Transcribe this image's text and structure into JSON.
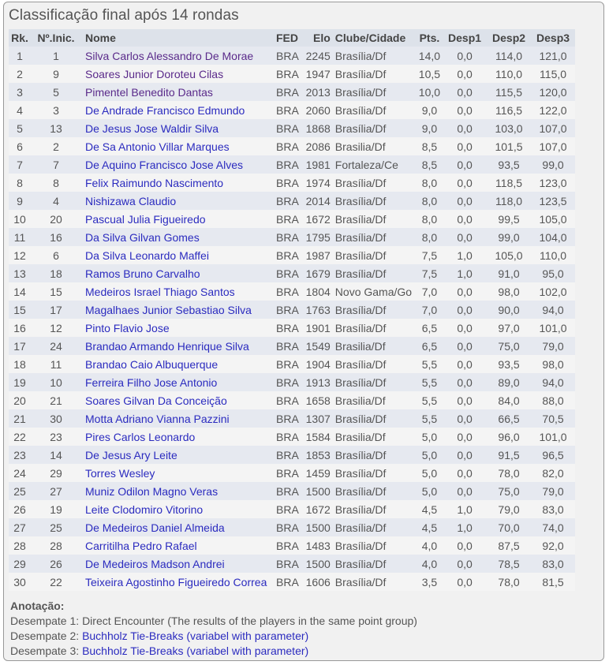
{
  "title": "Classificação final após 14 rondas",
  "columns": [
    "Rk.",
    "Nº.Inic.",
    "Nome",
    "FED",
    "Elo",
    "Clube/Cidade",
    "Pts.",
    "Desp1",
    "Desp2",
    "Desp3"
  ],
  "link_color": "#2b2bbf",
  "visited_link_color": "#5a2a8a",
  "rows": [
    {
      "rk": "1",
      "start": "1",
      "name": "Silva Carlos Alessandro De Morae",
      "fed": "BRA",
      "elo": "2245",
      "club": "Brasília/Df",
      "pts": "14,0",
      "d1": "0,0",
      "d2": "114,0",
      "d3": "121,0",
      "visited": true
    },
    {
      "rk": "2",
      "start": "9",
      "name": "Soares Junior Doroteu Cilas",
      "fed": "BRA",
      "elo": "1947",
      "club": "Brasília/Df",
      "pts": "10,5",
      "d1": "0,0",
      "d2": "110,0",
      "d3": "115,0",
      "visited": true
    },
    {
      "rk": "3",
      "start": "5",
      "name": "Pimentel Benedito Dantas",
      "fed": "BRA",
      "elo": "2013",
      "club": "Brasília/Df",
      "pts": "10,0",
      "d1": "0,0",
      "d2": "115,5",
      "d3": "120,0",
      "visited": true
    },
    {
      "rk": "4",
      "start": "3",
      "name": "De Andrade Francisco Edmundo",
      "fed": "BRA",
      "elo": "2060",
      "club": "Brasília/Df",
      "pts": "9,0",
      "d1": "0,0",
      "d2": "116,5",
      "d3": "122,0"
    },
    {
      "rk": "5",
      "start": "13",
      "name": "De Jesus Jose Waldir Silva",
      "fed": "BRA",
      "elo": "1868",
      "club": "Brasília/Df",
      "pts": "9,0",
      "d1": "0,0",
      "d2": "103,0",
      "d3": "107,0"
    },
    {
      "rk": "6",
      "start": "2",
      "name": "De Sa Antonio Villar Marques",
      "fed": "BRA",
      "elo": "2086",
      "club": "Brasilia/Df",
      "pts": "8,5",
      "d1": "0,0",
      "d2": "101,5",
      "d3": "107,0"
    },
    {
      "rk": "7",
      "start": "7",
      "name": "De Aquino Francisco Jose Alves",
      "fed": "BRA",
      "elo": "1981",
      "club": "Fortaleza/Ce",
      "pts": "8,5",
      "d1": "0,0",
      "d2": "93,5",
      "d3": "99,0"
    },
    {
      "rk": "8",
      "start": "8",
      "name": "Felix Raimundo Nascimento",
      "fed": "BRA",
      "elo": "1974",
      "club": "Brasília/Df",
      "pts": "8,0",
      "d1": "0,0",
      "d2": "118,5",
      "d3": "123,0"
    },
    {
      "rk": "9",
      "start": "4",
      "name": "Nishizawa Claudio",
      "fed": "BRA",
      "elo": "2014",
      "club": "Brasília/Df",
      "pts": "8,0",
      "d1": "0,0",
      "d2": "118,0",
      "d3": "123,5"
    },
    {
      "rk": "10",
      "start": "20",
      "name": "Pascual Julia Figueiredo",
      "fed": "BRA",
      "elo": "1672",
      "club": "Brasília/Df",
      "pts": "8,0",
      "d1": "0,0",
      "d2": "99,5",
      "d3": "105,0"
    },
    {
      "rk": "11",
      "start": "16",
      "name": "Da Silva Gilvan Gomes",
      "fed": "BRA",
      "elo": "1795",
      "club": "Brasília/Df",
      "pts": "8,0",
      "d1": "0,0",
      "d2": "99,0",
      "d3": "104,0"
    },
    {
      "rk": "12",
      "start": "6",
      "name": "Da Silva Leonardo Maffei",
      "fed": "BRA",
      "elo": "1987",
      "club": "Brasília/Df",
      "pts": "7,5",
      "d1": "1,0",
      "d2": "105,0",
      "d3": "110,0"
    },
    {
      "rk": "13",
      "start": "18",
      "name": "Ramos Bruno Carvalho",
      "fed": "BRA",
      "elo": "1679",
      "club": "Brasília/Df",
      "pts": "7,5",
      "d1": "1,0",
      "d2": "91,0",
      "d3": "95,0"
    },
    {
      "rk": "14",
      "start": "15",
      "name": "Medeiros Israel Thiago Santos",
      "fed": "BRA",
      "elo": "1804",
      "club": "Novo Gama/Go",
      "pts": "7,0",
      "d1": "0,0",
      "d2": "98,0",
      "d3": "102,0"
    },
    {
      "rk": "15",
      "start": "17",
      "name": "Magalhaes Junior Sebastiao Silva",
      "fed": "BRA",
      "elo": "1763",
      "club": "Brasília/Df",
      "pts": "7,0",
      "d1": "0,0",
      "d2": "90,0",
      "d3": "94,0"
    },
    {
      "rk": "16",
      "start": "12",
      "name": "Pinto Flavio Jose",
      "fed": "BRA",
      "elo": "1901",
      "club": "Brasília/Df",
      "pts": "6,5",
      "d1": "0,0",
      "d2": "97,0",
      "d3": "101,0"
    },
    {
      "rk": "17",
      "start": "24",
      "name": "Brandao Armando Henrique Silva",
      "fed": "BRA",
      "elo": "1549",
      "club": "Brasilia/Df",
      "pts": "6,5",
      "d1": "0,0",
      "d2": "75,0",
      "d3": "79,0"
    },
    {
      "rk": "18",
      "start": "11",
      "name": "Brandao Caio Albuquerque",
      "fed": "BRA",
      "elo": "1904",
      "club": "Brasília/Df",
      "pts": "5,5",
      "d1": "0,0",
      "d2": "93,5",
      "d3": "98,0"
    },
    {
      "rk": "19",
      "start": "10",
      "name": "Ferreira Filho Jose Antonio",
      "fed": "BRA",
      "elo": "1913",
      "club": "Brasília/Df",
      "pts": "5,5",
      "d1": "0,0",
      "d2": "89,0",
      "d3": "94,0"
    },
    {
      "rk": "20",
      "start": "21",
      "name": "Soares Gilvan Da Conceição",
      "fed": "BRA",
      "elo": "1658",
      "club": "Brasilia/Df",
      "pts": "5,5",
      "d1": "0,0",
      "d2": "84,0",
      "d3": "88,0"
    },
    {
      "rk": "21",
      "start": "30",
      "name": "Motta Adriano Vianna Pazzini",
      "fed": "BRA",
      "elo": "1307",
      "club": "Brasília/Df",
      "pts": "5,5",
      "d1": "0,0",
      "d2": "66,5",
      "d3": "70,5"
    },
    {
      "rk": "22",
      "start": "23",
      "name": "Pires Carlos Leonardo",
      "fed": "BRA",
      "elo": "1584",
      "club": "Brasilia/Df",
      "pts": "5,0",
      "d1": "0,0",
      "d2": "96,0",
      "d3": "101,0"
    },
    {
      "rk": "23",
      "start": "14",
      "name": "De Jesus Ary Leite",
      "fed": "BRA",
      "elo": "1853",
      "club": "Brasília/Df",
      "pts": "5,0",
      "d1": "0,0",
      "d2": "91,5",
      "d3": "96,5"
    },
    {
      "rk": "24",
      "start": "29",
      "name": "Torres Wesley",
      "fed": "BRA",
      "elo": "1459",
      "club": "Brasília/Df",
      "pts": "5,0",
      "d1": "0,0",
      "d2": "78,0",
      "d3": "82,0"
    },
    {
      "rk": "25",
      "start": "27",
      "name": "Muniz Odilon Magno Veras",
      "fed": "BRA",
      "elo": "1500",
      "club": "Brasília/Df",
      "pts": "5,0",
      "d1": "0,0",
      "d2": "75,0",
      "d3": "79,0"
    },
    {
      "rk": "26",
      "start": "19",
      "name": "Leite Clodomiro Vitorino",
      "fed": "BRA",
      "elo": "1672",
      "club": "Brasília/Df",
      "pts": "4,5",
      "d1": "1,0",
      "d2": "79,0",
      "d3": "83,0"
    },
    {
      "rk": "27",
      "start": "25",
      "name": "De Medeiros Daniel Almeida",
      "fed": "BRA",
      "elo": "1500",
      "club": "Brasília/Df",
      "pts": "4,5",
      "d1": "1,0",
      "d2": "70,0",
      "d3": "74,0"
    },
    {
      "rk": "28",
      "start": "28",
      "name": "Carritilha Pedro Rafael",
      "fed": "BRA",
      "elo": "1483",
      "club": "Brasília/Df",
      "pts": "4,0",
      "d1": "0,0",
      "d2": "87,5",
      "d3": "92,0"
    },
    {
      "rk": "29",
      "start": "26",
      "name": "De Medeiros Madson Andrei",
      "fed": "BRA",
      "elo": "1500",
      "club": "Brasília/Df",
      "pts": "4,0",
      "d1": "0,0",
      "d2": "78,5",
      "d3": "83,0"
    },
    {
      "rk": "30",
      "start": "22",
      "name": "Teixeira Agostinho Figueiredo Correa",
      "fed": "BRA",
      "elo": "1606",
      "club": "Brasília/Df",
      "pts": "3,5",
      "d1": "0,0",
      "d2": "78,0",
      "d3": "81,5"
    }
  ],
  "notes": {
    "heading": "Anotação:",
    "items": [
      {
        "label": "Desempate 1: ",
        "text": "Direct Encounter (The results of the players in the same point group)",
        "link": false
      },
      {
        "label": "Desempate 2: ",
        "text": "Buchholz Tie-Breaks (variabel with parameter)",
        "link": true
      },
      {
        "label": "Desempate 3: ",
        "text": "Buchholz Tie-Breaks (variabel with parameter)",
        "link": true
      }
    ]
  }
}
